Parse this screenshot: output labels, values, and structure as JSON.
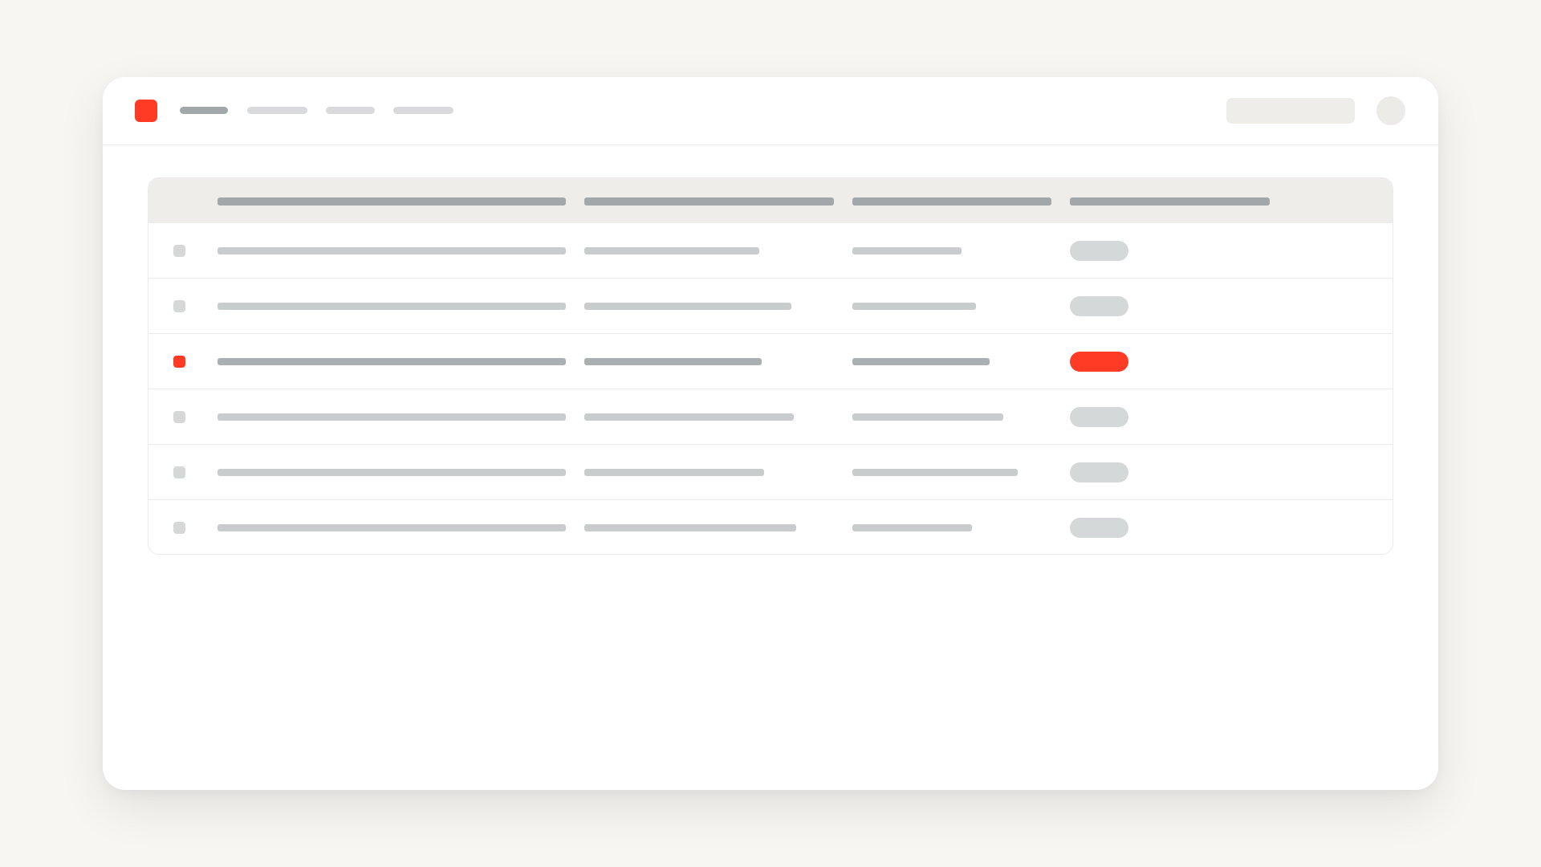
{
  "colors": {
    "accent": "#ff3b25",
    "neutral": "#d5d8d9",
    "background": "#f7f6f3"
  },
  "topbar": {
    "logo_icon": "app-logo-icon",
    "nav_items": [
      {
        "label": "",
        "active": true
      },
      {
        "label": "",
        "active": false
      },
      {
        "label": "",
        "active": false
      },
      {
        "label": "",
        "active": false
      }
    ],
    "search": {
      "value": "",
      "placeholder": ""
    },
    "avatar_icon": "user-avatar-icon"
  },
  "table": {
    "columns": [
      "",
      "",
      "",
      ""
    ],
    "rows": [
      {
        "selected": false,
        "cells": [
          "",
          "",
          ""
        ],
        "status": "",
        "status_color": "#d5d8d9",
        "fill": [
          1.0,
          0.7,
          0.55
        ]
      },
      {
        "selected": false,
        "cells": [
          "",
          "",
          ""
        ],
        "status": "",
        "status_color": "#d5d8d9",
        "fill": [
          1.0,
          0.83,
          0.62
        ]
      },
      {
        "selected": true,
        "cells": [
          "",
          "",
          ""
        ],
        "status": "",
        "status_color": "#ff3b25",
        "fill": [
          1.0,
          0.71,
          0.69
        ]
      },
      {
        "selected": false,
        "cells": [
          "",
          "",
          ""
        ],
        "status": "",
        "status_color": "#d5d8d9",
        "fill": [
          1.0,
          0.84,
          0.76
        ]
      },
      {
        "selected": false,
        "cells": [
          "",
          "",
          ""
        ],
        "status": "",
        "status_color": "#d5d8d9",
        "fill": [
          1.0,
          0.72,
          0.83
        ]
      },
      {
        "selected": false,
        "cells": [
          "",
          "",
          ""
        ],
        "status": "",
        "status_color": "#d5d8d9",
        "fill": [
          1.0,
          0.85,
          0.6
        ]
      }
    ]
  }
}
